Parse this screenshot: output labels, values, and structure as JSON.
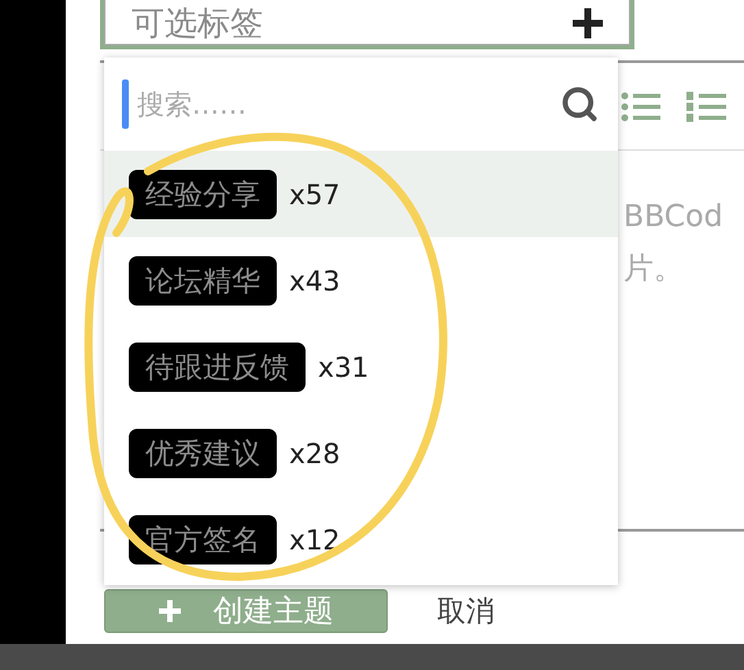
{
  "tag_select": {
    "placeholder": "可选标签"
  },
  "tag_dropdown": {
    "search": {
      "placeholder": "搜索……"
    },
    "tags": [
      {
        "name": "经验分享",
        "count": "x57",
        "selected": true
      },
      {
        "name": "论坛精华",
        "count": "x43",
        "selected": false
      },
      {
        "name": "待跟进反馈",
        "count": "x31",
        "selected": false
      },
      {
        "name": "优秀建议",
        "count": "x28",
        "selected": false
      },
      {
        "name": "官方签名",
        "count": "x12",
        "selected": false
      }
    ]
  },
  "editor": {
    "text_lines": [
      "BBCod",
      "片。"
    ]
  },
  "actions": {
    "create_button": "创建主题",
    "cancel_link": "取消"
  }
}
